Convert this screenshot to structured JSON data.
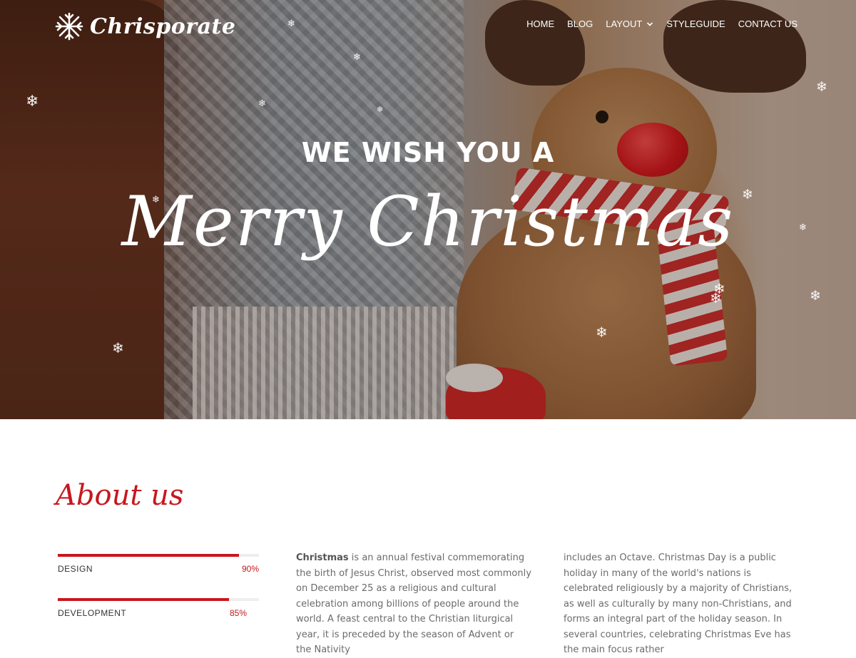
{
  "brand": {
    "name": "Chrisporate",
    "icon": "snowflake-icon"
  },
  "nav": {
    "items": [
      {
        "label": "HOME"
      },
      {
        "label": "BLOG"
      },
      {
        "label": "LAYOUT",
        "icon": "chevron-down-icon"
      },
      {
        "label": "STYLEGUIDE"
      },
      {
        "label": "CONTACT US"
      }
    ]
  },
  "hero": {
    "subtitle": "WE WISH YOU A",
    "title": "Merry Christmas"
  },
  "about": {
    "title": "About us",
    "skills": [
      {
        "name": "DESIGN",
        "percent_label": "90%",
        "value": 0.9
      },
      {
        "name": "DEVELOPMENT",
        "percent_label": "85%",
        "value": 0.85
      }
    ],
    "col1": {
      "bold": "Christmas",
      "text": " is an annual festival commemorating the birth of Jesus Christ, observed most commonly on December 25 as a religious and cultural celebration among billions of people around the world. A feast central to the Christian liturgical year, it is preceded by the season of Advent or the Nativity"
    },
    "col2": {
      "text": "includes an Octave. Christmas Day is a public holiday in many of the world's nations is celebrated religiously by a majority of Christians, as well as culturally by many non-Christians, and forms an integral part of the holiday season. In several countries, celebrating Christmas Eve has the main focus rather"
    }
  },
  "colors": {
    "accent": "#c8161d",
    "text": "#6b6b6b",
    "hero_text": "#ffffff"
  }
}
